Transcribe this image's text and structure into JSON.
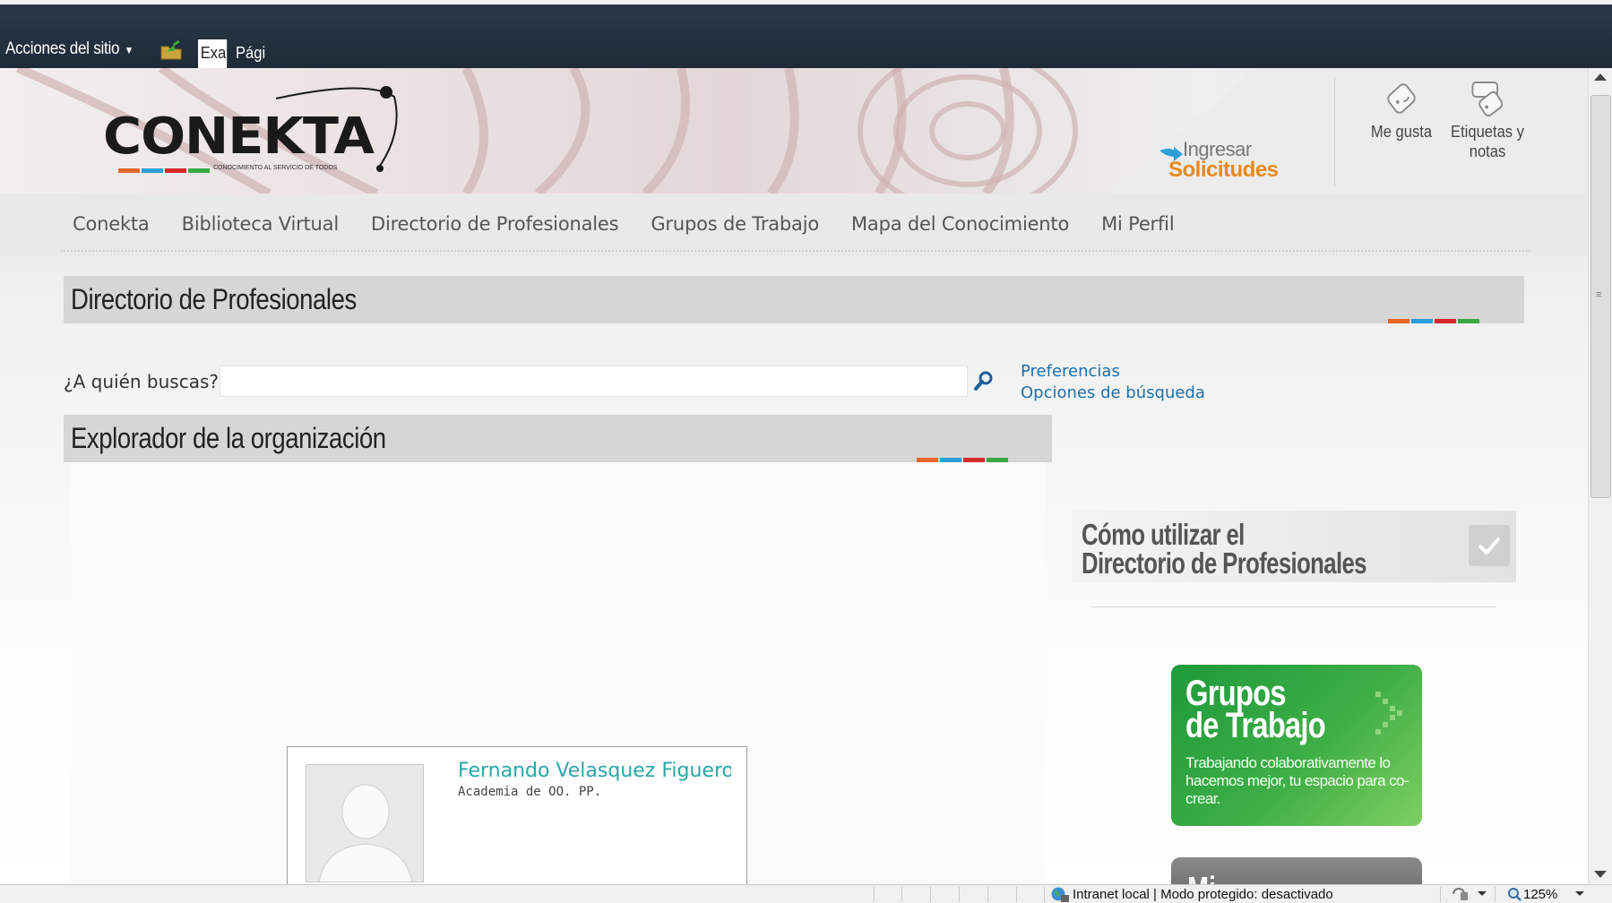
{
  "ribbon": {
    "site_actions": "Acciones del sitio",
    "tab_1": "Exami",
    "tab_2": "Pági"
  },
  "header": {
    "logo_text": "CONEKTA",
    "logo_tagline": "CONOCIMIENTO AL SERVICIO DE TODOS",
    "logo_colors": [
      "#e8662a",
      "#2a9fd8",
      "#d6282d",
      "#3aa845"
    ],
    "ingresar": "Ingresar",
    "solicitudes": "Solicitudes",
    "me_gusta": "Me gusta",
    "etiquetas_line1": "Etiquetas y",
    "etiquetas_line2": "notas"
  },
  "topnav": {
    "items": [
      {
        "label": "Conekta"
      },
      {
        "label": "Biblioteca Virtual"
      },
      {
        "label": "Directorio de Profesionales"
      },
      {
        "label": "Grupos de Trabajo"
      },
      {
        "label": "Mapa del Conocimiento"
      },
      {
        "label": "Mi Perfil"
      }
    ]
  },
  "directory": {
    "title": "Directorio de Profesionales",
    "search_label": "¿A quién buscas?",
    "search_value": "",
    "preferences": "Preferencias",
    "search_options": "Opciones de búsqueda"
  },
  "org": {
    "title": "Explorador de la organización",
    "person_name": "Fernando Velasquez Figueroa",
    "person_dept": "Academia de OO. PP."
  },
  "sidebar": {
    "howto_line1": "Cómo utilizar el",
    "howto_line2": "Directorio de Profesionales",
    "groups_title_line1": "Grupos",
    "groups_title_line2": "de Trabajo",
    "groups_desc": "Trabajando colaborativamente lo hacemos mejor, tu espacio para co-crear.",
    "profile_title_partial": "Mi"
  },
  "status": {
    "zone": "Intranet local | Modo protegido: desactivado",
    "zoom": "125%"
  },
  "colors": {
    "ribbon": "#1e2a38",
    "accent_orange": "#e8891d",
    "link_blue": "#1f6fa8",
    "name_teal": "#2aa6a6",
    "groups_green": "#3eae47"
  }
}
